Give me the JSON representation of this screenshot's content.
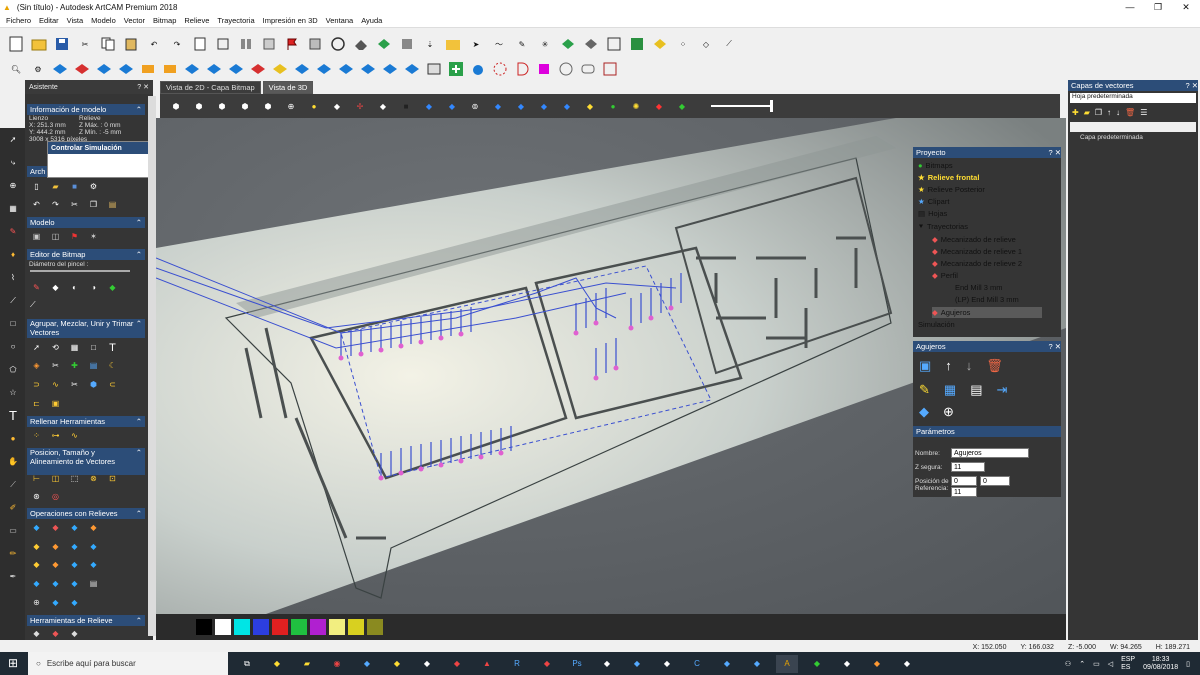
{
  "window": {
    "title": "(Sin título) - Autodesk ArtCAM Premium 2018",
    "min": "—",
    "max": "❐",
    "close": "✕"
  },
  "menu": [
    "Fichero",
    "Editar",
    "Vista",
    "Modelo",
    "Vector",
    "Bitmap",
    "Relieve",
    "Trayectoria",
    "Impresión en 3D",
    "Ventana",
    "Ayuda"
  ],
  "wizard": {
    "title": "Asistente",
    "info": {
      "title": "Información de modelo",
      "lienzo": "Lienzo",
      "relieve": "Relieve",
      "x": "X: 251.3 mm",
      "zmax": "Z Máx. : 0 mm",
      "y": "Y: 444.2 mm",
      "zmin": "Z Mín. : -5 mm",
      "px": "3008 x 5316 píxeles"
    },
    "sim_popup": "Controlar Simulación",
    "archivo": "Arch",
    "modelo": "Modelo",
    "editor": "Editor de Bitmap",
    "diametro": "Diámetro del pincel :",
    "agrupar": "Agrupar, Mezclar, Unir y Trimar Vectores",
    "rellenar": "Rellenar Herramientas",
    "posicion": "Posicion, Tamaño y Alineamiento de Vectores",
    "operaciones": "Operaciones con Relieves",
    "herramientas": "Herramientas de Relieve"
  },
  "tabs": [
    "Vista de 2D - Capa Bitmap",
    "Vista de 3D"
  ],
  "project": {
    "title": "Proyecto",
    "items": [
      "Bitmaps",
      "Relieve frontal",
      "Relieve Posterior",
      "Clipart",
      "Hojas",
      "Trayectorias",
      "Mecanizado de relieve",
      "Mecanizado de relieve 1",
      "Mecanizado de relieve 2",
      "Perfil",
      "End Mill 3 mm",
      "(LP) End Mill 3 mm",
      "Agujeros",
      "Simulación"
    ]
  },
  "agujeros": {
    "title": "Agujeros",
    "params": "Parámetros",
    "nombre_l": "Nombre:",
    "nombre_v": "Agujeros",
    "zseg_l": "Z segura:",
    "zseg_v": "11",
    "pos_l": "Posición de Referencia:",
    "pos_x": "0",
    "pos_y": "0",
    "pos_z": "11"
  },
  "layers": {
    "title": "Capas de vectores",
    "preset": "Hoja predeterminada",
    "layer": "Capa predeterminada"
  },
  "status": {
    "x": "X: 152.050",
    "y": "Y: 166.032",
    "z": "Z: -5.000",
    "w": "W: 94.265",
    "h": "H: 189.271"
  },
  "taskbar": {
    "search": "Escribe aquí para buscar",
    "lang1": "ESP",
    "lang2": "ES",
    "time": "18:33",
    "date": "09/08/2018"
  },
  "palette": [
    "#000000",
    "#ffffff",
    "#00e5e5",
    "#2c3ee0",
    "#e02020",
    "#20c040",
    "#b020d0",
    "#f2ee80",
    "#d8d020",
    "#8a8a20"
  ]
}
